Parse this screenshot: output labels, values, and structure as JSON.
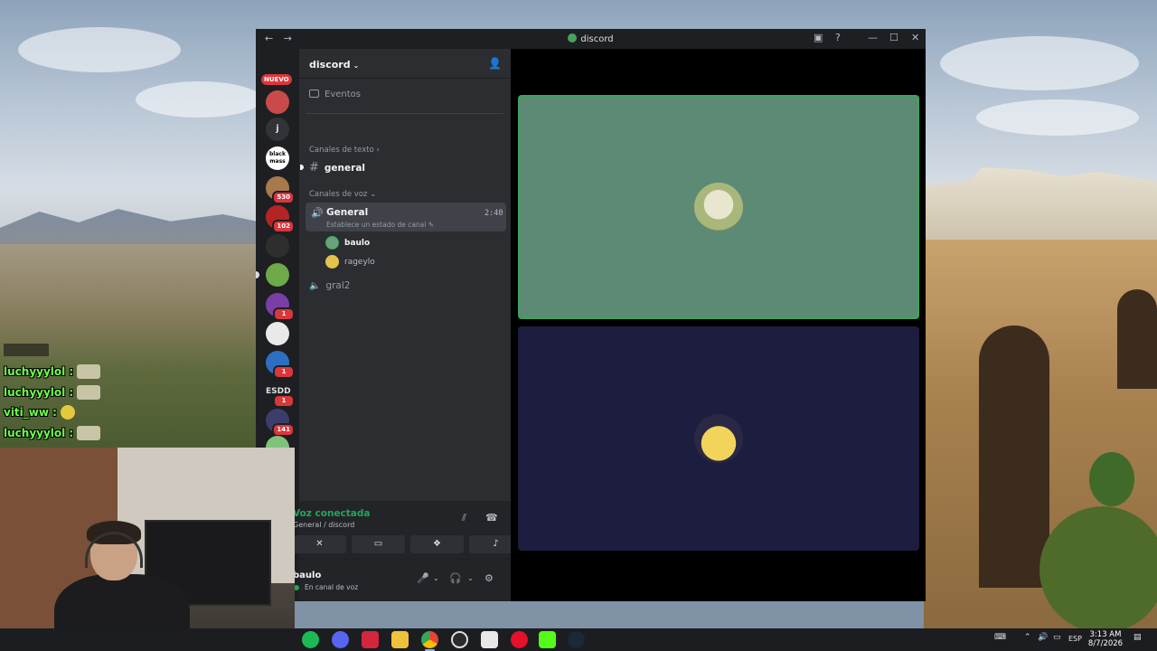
{
  "chat": [
    {
      "user": "luchyyylol :",
      "emote": "pepe-emote"
    },
    {
      "user": "luchyyylol :",
      "emote": "pepe-emote"
    },
    {
      "user": "viti_ww :",
      "emote": "smile-emote"
    },
    {
      "user": "luchyyylol :",
      "emote": "pepe-emote"
    }
  ],
  "window": {
    "title": "discord",
    "nav": "← →",
    "icons": [
      "inbox-icon",
      "help-icon",
      "minimize-icon",
      "maximize-icon",
      "close-icon"
    ]
  },
  "rail": {
    "nuevo_label": "NUEVO",
    "servers": [
      {
        "name": "server-1",
        "badge": "",
        "color": "#c94a4a",
        "text": ""
      },
      {
        "name": "server-j",
        "badge": "",
        "color": "#313338",
        "text": "j"
      },
      {
        "name": "server-black-mass",
        "badge": "",
        "color": "#ffffff",
        "text": "black mass"
      },
      {
        "name": "server-4",
        "badge": "530",
        "color": "#a8794a",
        "text": ""
      },
      {
        "name": "server-5",
        "badge": "102",
        "color": "#b52424",
        "text": ""
      },
      {
        "name": "server-6",
        "badge": "",
        "color": "#2e2e2e",
        "text": ""
      },
      {
        "name": "server-7",
        "badge": "",
        "color": "#6ea94a",
        "text": ""
      },
      {
        "name": "server-8",
        "badge": "1",
        "color": "#7b3ea5",
        "text": ""
      },
      {
        "name": "server-9",
        "badge": "",
        "color": "#e9e9e9",
        "text": ""
      },
      {
        "name": "server-10",
        "badge": "1",
        "color": "#2c6fc2",
        "text": ""
      },
      {
        "name": "server-esdd",
        "badge": "1",
        "color": "#1e1f22",
        "text": "ESDD"
      },
      {
        "name": "server-12",
        "badge": "141",
        "color": "#3b3e6b",
        "text": ""
      },
      {
        "name": "server-13",
        "badge": "",
        "color": "#7fc27a",
        "text": ""
      }
    ]
  },
  "guild": {
    "name": "discord",
    "events_label": "Eventos",
    "text_category": "Canales de texto",
    "text_channel": "general",
    "voice_category": "Canales de voz",
    "voice_channel": "General",
    "voice_status": "Establece un estado de canal",
    "voice_timer": "2:40",
    "members": [
      {
        "name": "baulo",
        "color": "#6aa37a",
        "text_color": "#f2f3f5"
      },
      {
        "name": "rageylo",
        "color": "#e5c24a",
        "text_color": "#b5bac1"
      }
    ],
    "voice_channel_2": "gral2"
  },
  "voice_panel": {
    "title": "Voz conectada",
    "subtitle": "General / discord"
  },
  "user_panel": {
    "name": "baulo",
    "status": "En canal de voz"
  },
  "stage": {
    "tiles": [
      {
        "user": "baulo",
        "bg": "#5c8a74",
        "speaking": true
      },
      {
        "user": "rageylo",
        "bg": "#1d1d3f",
        "speaking": false
      }
    ]
  },
  "taskbar": {
    "apps": [
      "spotify",
      "discord-beta",
      "app-3",
      "file-explorer",
      "chrome",
      "obs",
      "app-7",
      "opera-gx",
      "kick",
      "steam"
    ],
    "lang": "ESP",
    "time": "3:13 AM",
    "date": "8/7/2026"
  }
}
